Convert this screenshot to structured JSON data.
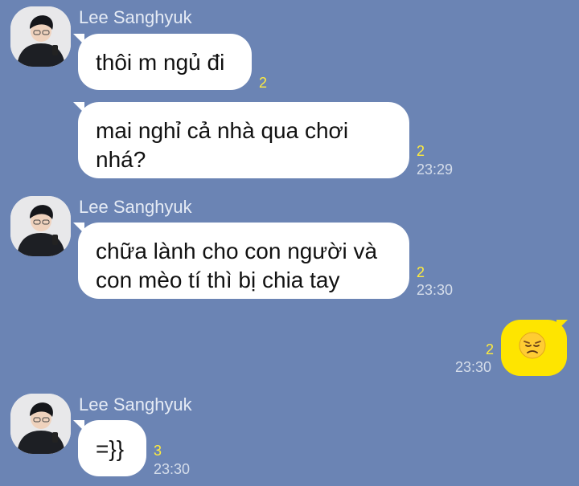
{
  "chat": {
    "messages": [
      {
        "sender": "Lee Sanghyuk",
        "bubbles": [
          {
            "text": "thôi m ngủ đi",
            "unread": "2",
            "time": ""
          },
          {
            "text": "mai nghỉ cả nhà qua chơi\nnhá?",
            "unread": "2",
            "time": "23:29"
          }
        ]
      },
      {
        "sender": "Lee Sanghyuk",
        "bubbles": [
          {
            "text": "chữa lành cho con người và\ncon mèo tí thì bị chia tay",
            "unread": "2",
            "time": "23:30"
          }
        ]
      },
      {
        "sender": "me",
        "bubbles": [
          {
            "emoji_icon": "disappointed-face-emoji",
            "unread": "2",
            "time": "23:30"
          }
        ]
      },
      {
        "sender": "Lee Sanghyuk",
        "bubbles": [
          {
            "text": "=}}",
            "unread": "3",
            "time": "23:30"
          }
        ]
      }
    ]
  },
  "colors": {
    "background": "#6b84b4",
    "incoming_bubble": "#ffffff",
    "outgoing_bubble": "#fee500",
    "unread_count": "#ffec3d",
    "sender_name": "#e5ebf5"
  },
  "icons": {
    "avatar": "profile-photo-avatar",
    "sent_emoji": "disappointed-face-emoji"
  }
}
